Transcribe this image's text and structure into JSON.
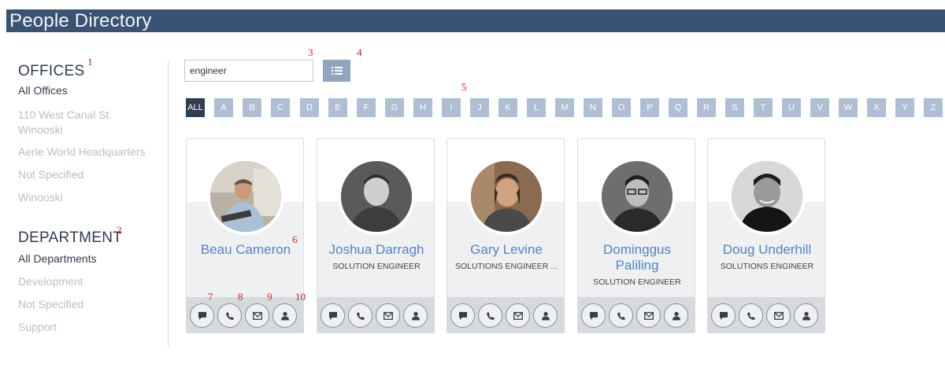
{
  "header": {
    "title": "People Directory"
  },
  "annotations": [
    "1",
    "2",
    "3",
    "4",
    "5",
    "6",
    "7",
    "8",
    "9",
    "10"
  ],
  "offices": {
    "title": "OFFICES",
    "items": [
      {
        "label": "All Offices"
      },
      {
        "label": "110 West Canal St."
      },
      {
        "label": "Winooski"
      },
      {
        "label": "Aerie World Headquarters"
      },
      {
        "label": "Not Specified"
      },
      {
        "label": "Winooski"
      }
    ]
  },
  "department": {
    "title": "DEPARTMENT",
    "items": [
      {
        "label": "All Departments"
      },
      {
        "label": "Development"
      },
      {
        "label": "Not Specified"
      },
      {
        "label": "Support"
      }
    ]
  },
  "search": {
    "value": "engineer"
  },
  "view_toggle": {
    "icon": "list-icon"
  },
  "alphabet": [
    "ALL",
    "A",
    "B",
    "C",
    "D",
    "E",
    "F",
    "G",
    "H",
    "I",
    "J",
    "K",
    "L",
    "M",
    "N",
    "O",
    "P",
    "Q",
    "R",
    "S",
    "T",
    "U",
    "V",
    "W",
    "X",
    "Y",
    "Z"
  ],
  "people": [
    {
      "name": "Beau Cameron",
      "role": ""
    },
    {
      "name": "Joshua Darragh",
      "role": "SOLUTION ENGINEER"
    },
    {
      "name": "Gary Levine",
      "role": "SOLUTIONS ENGINEER ..."
    },
    {
      "name_line1": "Dominggus",
      "name_line2": "Paliling",
      "role": "SOLUTION ENGINEER"
    },
    {
      "name": "Doug Underhill",
      "role": "SOLUTIONS ENGINEER"
    }
  ],
  "card_actions": [
    "chat-icon",
    "phone-icon",
    "mail-icon",
    "profile-icon"
  ],
  "colors": {
    "header_bg": "#3a5373",
    "accent_blue": "#4f86c6",
    "alpha_bg": "#aebfd4",
    "alpha_active": "#2c3e52",
    "annotation_red": "#d42020"
  }
}
